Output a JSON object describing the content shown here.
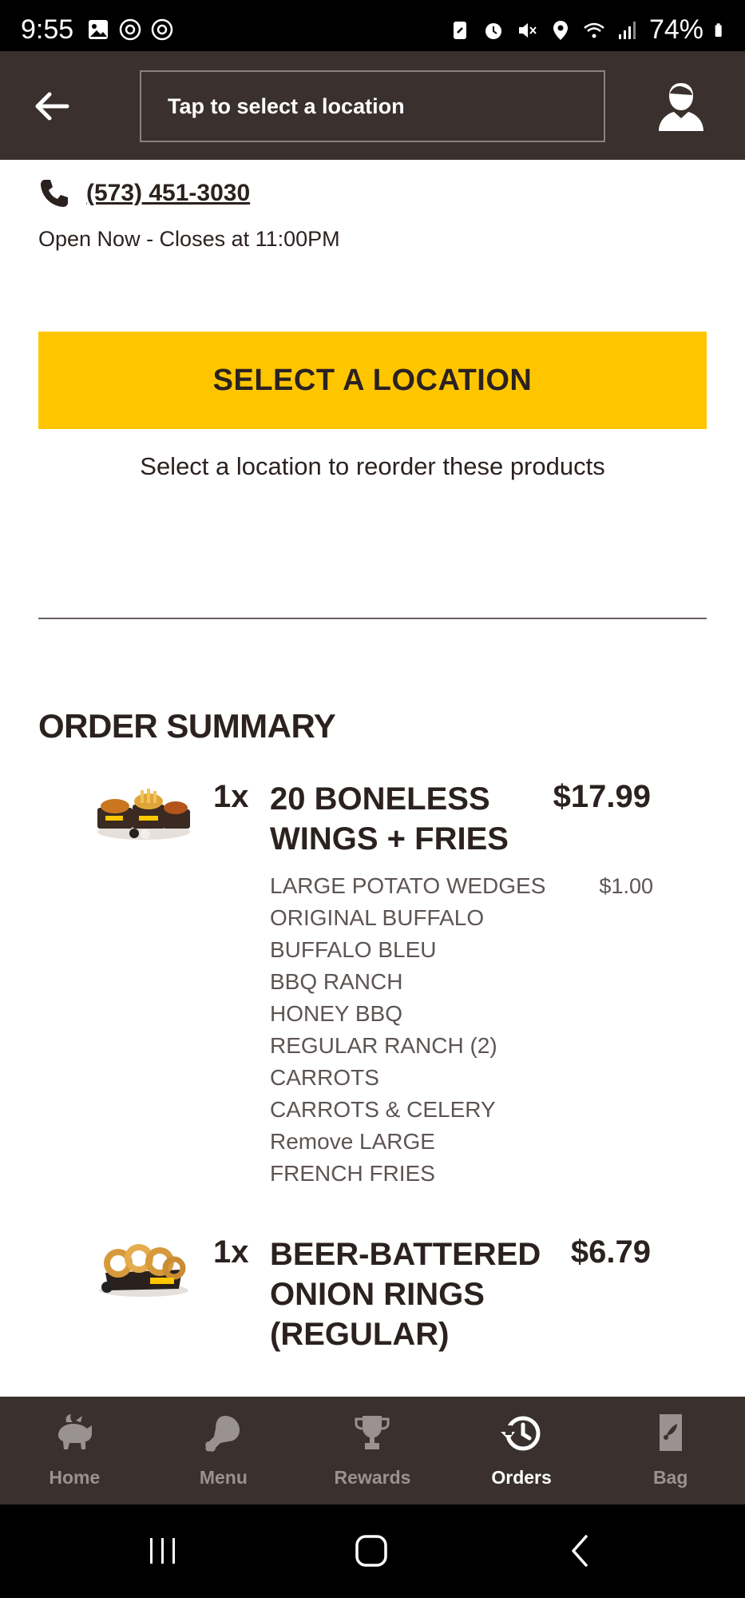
{
  "status_bar": {
    "time": "9:55",
    "battery": "74%"
  },
  "header": {
    "location_placeholder": "Tap to select a location"
  },
  "store": {
    "phone": "(573) 451-3030",
    "hours": "Open Now - Closes at 11:00PM"
  },
  "actions": {
    "select_location_label": "SELECT A LOCATION",
    "select_location_hint": "Select a location to reorder these products"
  },
  "order_summary": {
    "title": "ORDER SUMMARY",
    "items": [
      {
        "qty": "1x",
        "name": "20 BONELESS WINGS + FRIES",
        "price": "$17.99",
        "modifiers": [
          {
            "label": "LARGE POTATO WEDGES",
            "price": "$1.00"
          },
          {
            "label": "ORIGINAL BUFFALO"
          },
          {
            "label": "BUFFALO BLEU"
          },
          {
            "label": "BBQ RANCH"
          },
          {
            "label": "HONEY BBQ"
          },
          {
            "label": "REGULAR RANCH (2)"
          },
          {
            "label": "CARROTS"
          },
          {
            "label": "CARROTS & CELERY"
          },
          {
            "label": "Remove LARGE FRENCH FRIES"
          }
        ]
      },
      {
        "qty": "1x",
        "name": "BEER-BATTERED ONION RINGS (REGULAR)",
        "price": "$6.79"
      }
    ]
  },
  "tabs": [
    {
      "label": "Home",
      "icon": "buffalo-icon"
    },
    {
      "label": "Menu",
      "icon": "drumstick-icon"
    },
    {
      "label": "Rewards",
      "icon": "trophy-icon"
    },
    {
      "label": "Orders",
      "icon": "history-icon",
      "active": true
    },
    {
      "label": "Bag",
      "icon": "bag-icon"
    }
  ],
  "colors": {
    "header_bg": "#3a302d",
    "accent_yellow": "#ffc600",
    "text_dark": "#2b2220"
  }
}
